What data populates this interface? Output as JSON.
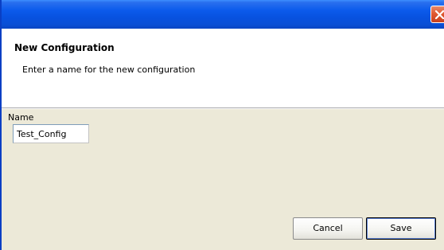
{
  "dialog": {
    "title": "New Configuration",
    "message": "Enter a name for the new configuration",
    "name_label": "Name",
    "name_value": "Test_Config",
    "cancel_label": "Cancel",
    "save_label": "Save"
  },
  "colors": {
    "titlebar": "#0a4fd6",
    "close_button": "#e05a32",
    "dialog_background": "#ece9d8",
    "header_background": "#ffffff"
  },
  "icons": {
    "close": "close-icon"
  }
}
